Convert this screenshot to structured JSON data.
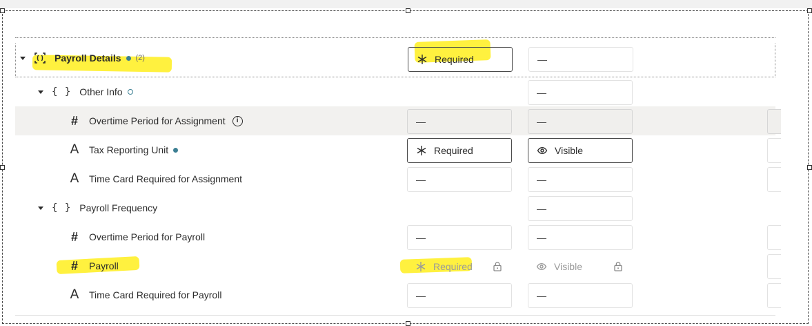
{
  "root": {
    "label": "Payroll Details",
    "count": "(2)",
    "required": "Required",
    "visible": "—"
  },
  "groups": {
    "other_info": {
      "label": "Other Info",
      "visible": "—",
      "fields": [
        {
          "label": "Overtime Period for Assignment",
          "required": "—",
          "visible": "—"
        },
        {
          "label": "Tax Reporting Unit",
          "required": "Required",
          "visible": "Visible"
        },
        {
          "label": "Time Card Required for Assignment",
          "required": "—",
          "visible": "—"
        }
      ]
    },
    "payroll_frequency": {
      "label": "Payroll Frequency",
      "visible": "—",
      "fields": [
        {
          "label": "Overtime Period for Payroll",
          "required": "—",
          "visible": "—"
        },
        {
          "label": "Payroll",
          "required": "Required",
          "visible": "Visible"
        },
        {
          "label": "Time Card Required for Payroll",
          "required": "—",
          "visible": "—"
        }
      ]
    }
  },
  "icons": {
    "object": "object-group-icon",
    "group": "braces-icon",
    "number": "hash-icon",
    "text": "letter-a-icon",
    "required": "asterisk-icon",
    "visible": "eye-icon",
    "lock": "lock-icon",
    "info": "info-icon"
  },
  "colors": {
    "dot": "#3c7f93",
    "highlight": "#ffef2a",
    "shaded_row": "#f2f1ef"
  }
}
